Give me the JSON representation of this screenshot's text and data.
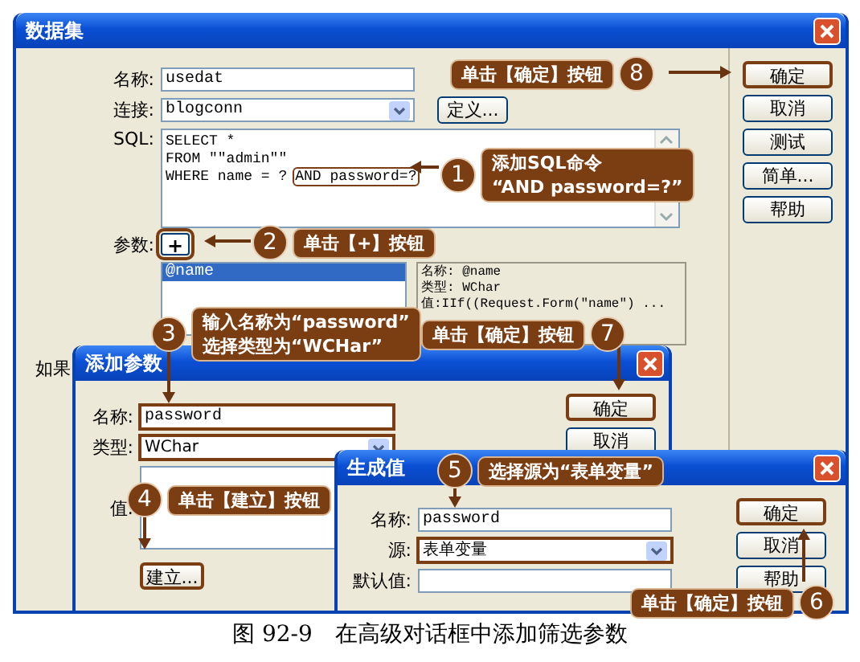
{
  "main_dialog": {
    "title": "数据集",
    "name": {
      "label": "名称:",
      "value": "usedat"
    },
    "connection": {
      "label": "连接:",
      "value": "blogconn",
      "button": "定义..."
    },
    "sql": {
      "label": "SQL:",
      "lines": [
        {
          "text": "SELECT *"
        },
        {
          "text": "FROM \"\"admin\"\""
        },
        {
          "text": "WHERE name = ?",
          "highlight": "AND password=?"
        }
      ]
    },
    "params": {
      "label": "参数:",
      "add_button": "+",
      "items": [
        {
          "label": "@name",
          "selected": true
        }
      ],
      "details": [
        "名称: @name",
        "类型: WChar",
        "值:IIf((Request.Form(\"name\") ..."
      ]
    },
    "note": "如果",
    "buttons": [
      {
        "label": "确定",
        "highlighted": true
      },
      {
        "label": "取消",
        "highlighted": false
      },
      {
        "label": "测试",
        "highlighted": false
      },
      {
        "label": "简单...",
        "highlighted": false
      },
      {
        "label": "帮助",
        "highlighted": false
      }
    ]
  },
  "add_param_dialog": {
    "title": "添加参数",
    "fields": [
      {
        "kind": "text",
        "label": "名称:",
        "value": "password",
        "highlighted": true
      },
      {
        "kind": "select",
        "label": "类型:",
        "value": "WChar",
        "highlighted": true
      },
      {
        "kind": "textarea",
        "label": "值:",
        "highlighted": false
      }
    ],
    "create_button": {
      "label": "建立...",
      "highlighted": true
    },
    "buttons": [
      {
        "label": "确定",
        "highlighted": true
      },
      {
        "label": "取消",
        "highlighted": false
      }
    ]
  },
  "generate_value_dialog": {
    "title": "生成值",
    "fields": [
      {
        "kind": "text",
        "label": "名称:",
        "value": "password",
        "highlighted": false
      },
      {
        "kind": "select",
        "label": "源:",
        "value": "表单变量",
        "highlighted": true
      },
      {
        "kind": "text",
        "label": "默认值:",
        "highlighted": false
      }
    ],
    "buttons": [
      {
        "label": "确定",
        "highlighted": true
      },
      {
        "label": "取消",
        "highlighted": false
      },
      {
        "label": "帮助",
        "highlighted": false
      }
    ]
  },
  "callouts": [
    {
      "number": "8",
      "lines": [
        "单击【确定】按钮"
      ]
    },
    {
      "number": "1",
      "lines": [
        "添加SQL命令",
        "“AND password=?”"
      ]
    },
    {
      "number": "2",
      "lines": [
        "单击【+】按钮"
      ]
    },
    {
      "number": "3",
      "lines": [
        "输入名称为“password”",
        "选择类型为“WCHar”"
      ]
    },
    {
      "number": "7",
      "lines": [
        "单击【确定】按钮"
      ]
    },
    {
      "number": "4",
      "lines": [
        "单击【建立】按钮"
      ]
    },
    {
      "number": "5",
      "lines": [
        "选择源为“表单变量”"
      ]
    },
    {
      "number": "6",
      "lines": [
        "单击【确定】按钮"
      ]
    }
  ],
  "caption": "图 92-9　在高级对话框中添加筛选参数"
}
